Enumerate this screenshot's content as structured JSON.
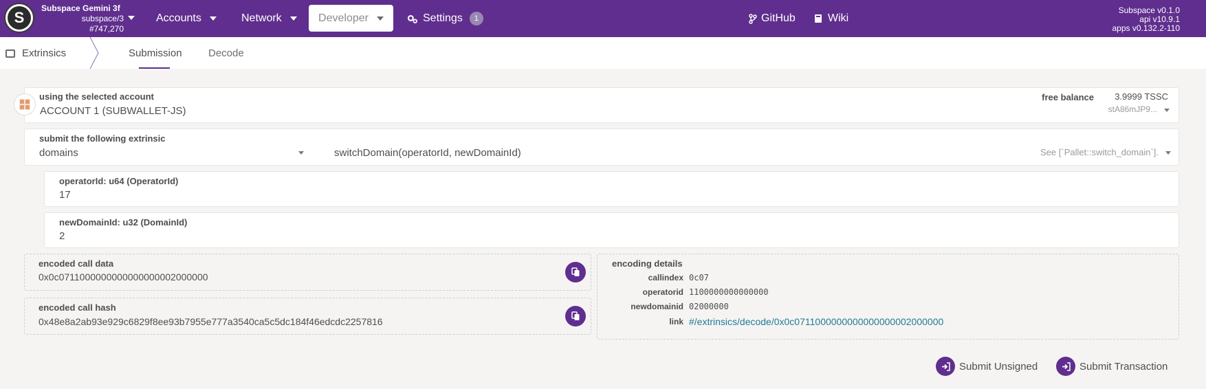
{
  "topbar": {
    "chain_name": "Subspace Gemini 3f",
    "chain_spec": "subspace/3",
    "block": "#747,270",
    "nav": {
      "accounts": "Accounts",
      "network": "Network",
      "developer": "Developer",
      "settings": "Settings",
      "settings_badge": "1",
      "github": "GitHub",
      "wiki": "Wiki"
    },
    "versions": [
      "Subspace v0.1.0",
      "api v10.9.1",
      "apps v0.132.2-110"
    ]
  },
  "subheader": {
    "title": "Extrinsics",
    "tabs": [
      "Submission",
      "Decode"
    ]
  },
  "account": {
    "label": "using the selected account",
    "name": "ACCOUNT 1 (SUBWALLET-JS)",
    "balance_label": "free balance",
    "balance_value": "3.9999 TSSC",
    "address": "stA86mJP9..."
  },
  "extrinsic": {
    "label": "submit the following extrinsic",
    "pallet": "domains",
    "method": "switchDomain(operatorId, newDomainId)",
    "doc_hint": "See [`Pallet::switch_domain`]."
  },
  "params": [
    {
      "label": "operatorId: u64 (OperatorId)",
      "value": "17"
    },
    {
      "label": "newDomainId: u32 (DomainId)",
      "value": "2"
    }
  ],
  "encoded_call_data": {
    "label": "encoded call data",
    "value": "0x0c0711000000000000000002000000"
  },
  "encoded_call_hash": {
    "label": "encoded call hash",
    "value": "0x48e8a2ab93e929c6829f8ee93b7955e777a3540ca5c5dc184f46edcdc2257816"
  },
  "encoding_details": {
    "title": "encoding details",
    "rows": [
      {
        "key": "callindex",
        "value": "0c07"
      },
      {
        "key": "operatorid",
        "value": "1100000000000000"
      },
      {
        "key": "newdomainid",
        "value": "02000000"
      },
      {
        "key": "link",
        "value": "#/extrinsics/decode/0x0c0711000000000000000002000000"
      }
    ]
  },
  "actions": {
    "submit_unsigned": "Submit Unsigned",
    "submit_transaction": "Submit Transaction"
  },
  "colors": {
    "brand": "#5f2e8e",
    "link": "#1f7a96",
    "background": "#f5f4f3"
  }
}
